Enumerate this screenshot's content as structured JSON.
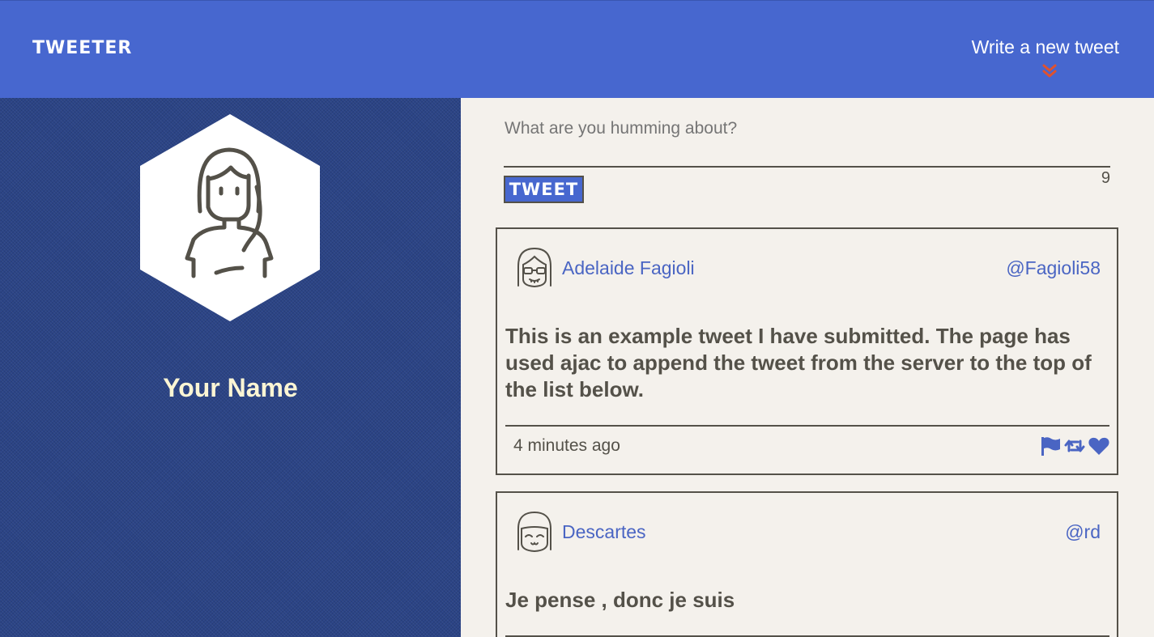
{
  "nav": {
    "brand": "TWEETER",
    "compose_label": "Write a new tweet",
    "compose_icon": "double-chevron-down-icon",
    "accent_color": "#4767cf",
    "chevron_color": "#e0522d"
  },
  "profile": {
    "name": "Your Name",
    "avatar_icon": "woman-avatar-icon"
  },
  "compose_form": {
    "placeholder": "What are you humming about?",
    "value": "",
    "submit_label": "TWEET",
    "counter": "9"
  },
  "tweets": [
    {
      "author": "Adelaide Fagioli",
      "handle": "@Fagioli58",
      "avatar_icon": "girl-glasses-avatar-icon",
      "content": "This is an example tweet I have submitted. The page has used ajac to append the tweet from the server to the top of the list below.",
      "time": "4 minutes ago",
      "actions": [
        "flag-icon",
        "retweet-icon",
        "heart-icon"
      ]
    },
    {
      "author": "Descartes",
      "handle": "@rd",
      "avatar_icon": "smiling-face-avatar-icon",
      "content": "Je pense , donc je suis"
    }
  ]
}
